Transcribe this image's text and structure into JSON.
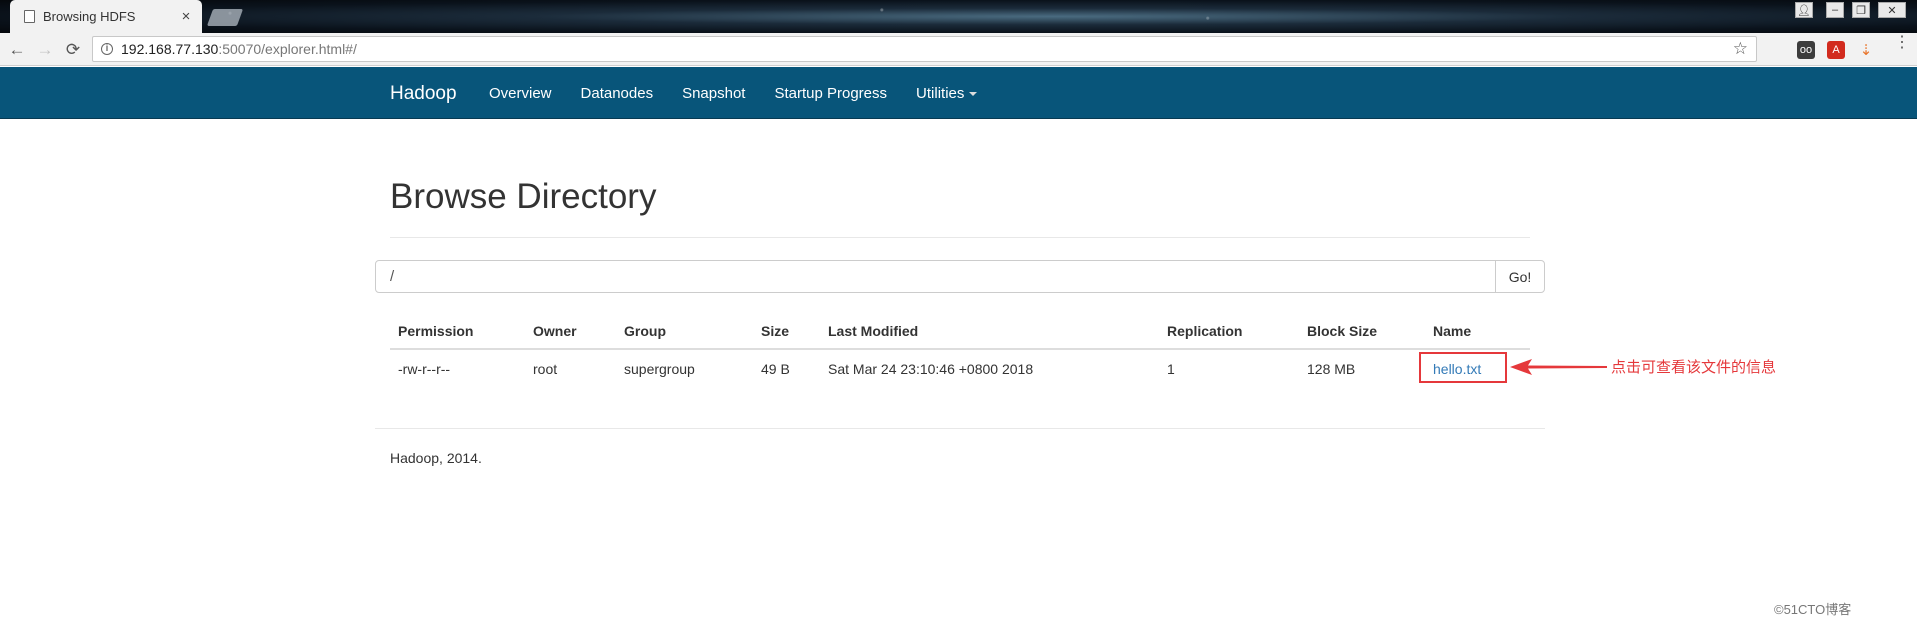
{
  "browser": {
    "tab_title": "Browsing HDFS",
    "url_host": "192.168.77.130",
    "url_rest": ":50070/explorer.html#/"
  },
  "navbar": {
    "brand": "Hadoop",
    "links": [
      "Overview",
      "Datanodes",
      "Snapshot",
      "Startup Progress",
      "Utilities"
    ]
  },
  "page": {
    "title": "Browse Directory",
    "path_value": "/",
    "go_label": "Go!"
  },
  "table": {
    "headers": [
      "Permission",
      "Owner",
      "Group",
      "Size",
      "Last Modified",
      "Replication",
      "Block Size",
      "Name"
    ],
    "rows": [
      {
        "permission": "-rw-r--r--",
        "owner": "root",
        "group": "supergroup",
        "size": "49 B",
        "last_modified": "Sat Mar 24 23:10:46 +0800 2018",
        "replication": "1",
        "block_size": "128 MB",
        "name": "hello.txt"
      }
    ]
  },
  "annotation": {
    "text": "点击可查看该文件的信息",
    "color": "#e5383b"
  },
  "footer": {
    "text": "Hadoop, 2014."
  },
  "watermark": "©51CTO博客",
  "colors": {
    "navbar_bg": "#08557a",
    "link": "#337ab7"
  },
  "icons": {
    "tab": "page-icon",
    "back": "arrow-left-icon",
    "forward": "arrow-right-icon",
    "reload": "reload-icon",
    "bookmark": "star-icon"
  }
}
